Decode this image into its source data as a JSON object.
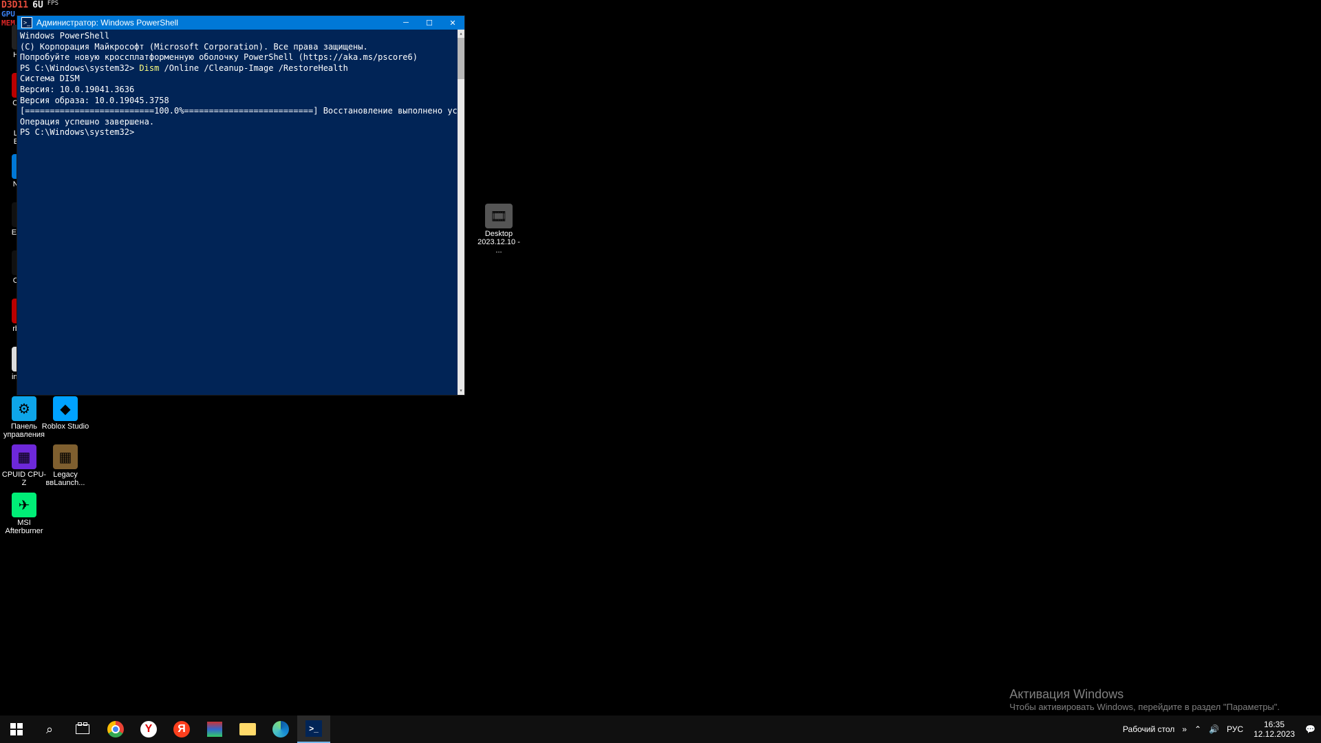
{
  "fps_overlay": {
    "api": "D3D11",
    "fps_value": "6U",
    "fps_label": "FPS",
    "gpu": "GPU",
    "mem": "MEM"
  },
  "desktop_icons_left": [
    {
      "label": "Hitm...",
      "color": "#222"
    },
    {
      "label": "OCC...",
      "color": "#b00"
    },
    {
      "label": "Epic...",
      "color": "#1a1a1a"
    },
    {
      "label": "Laur...",
      "color": "#1a1a1a"
    },
    {
      "label": "Nurs...",
      "color": "#0078d7"
    },
    {
      "label": "Every...",
      "color": "#111"
    },
    {
      "label": "OBS...",
      "color": "#111"
    },
    {
      "label": "rbxfp...",
      "color": "#b00"
    },
    {
      "label": "infour...",
      "color": "#ddd"
    }
  ],
  "desktop_icons_bottom": [
    {
      "label": "Панель управления",
      "color": "#0ea5e9"
    },
    {
      "label": "Roblox Studio",
      "color": "#00a2ff"
    },
    {
      "label": "CPUID CPU-Z",
      "color": "#6d28d9"
    },
    {
      "label": "Legacy ввLaunch...",
      "color": "#7f5f2f"
    },
    {
      "label": "MSI Afterburner",
      "color": "#0e7"
    }
  ],
  "desktop_icon_right": {
    "label": "Desktop 2023.12.10 - ..."
  },
  "terminal": {
    "title": "Администратор: Windows PowerShell",
    "lines": {
      "l1": "Windows PowerShell",
      "l2": "(C) Корпорация Майкрософт (Microsoft Corporation). Все права защищены.",
      "l3": "",
      "l4": "Попробуйте новую кроссплатформенную оболочку PowerShell (https://aka.ms/pscore6)",
      "l5": "",
      "prompt1_prefix": "PS C:\\Windows\\system32> ",
      "cmd_highlight": "Dism",
      "cmd_rest": " /Online /Cleanup-Image /RestoreHealth",
      "l7": "",
      "l8": "Система DISM",
      "l9": "Версия: 10.0.19041.3636",
      "l10": "",
      "l11": "Версия образа: 10.0.19045.3758",
      "l12": "",
      "l13": "[==========================100.0%==========================] Восстановление выполнено успешно.",
      "l14": "Операция успешно завершена.",
      "l15": "PS C:\\Windows\\system32>"
    }
  },
  "watermark": {
    "line1": "Активация Windows",
    "line2": "Чтобы активировать Windows, перейдите в раздел \"Параметры\"."
  },
  "taskbar": {
    "tray": {
      "desktop_label": "Рабочий стол",
      "overflow": "»",
      "chevron": "⌃",
      "volume": "🔊",
      "lang": "РУС",
      "time": "16:35",
      "date": "12.12.2023"
    }
  }
}
